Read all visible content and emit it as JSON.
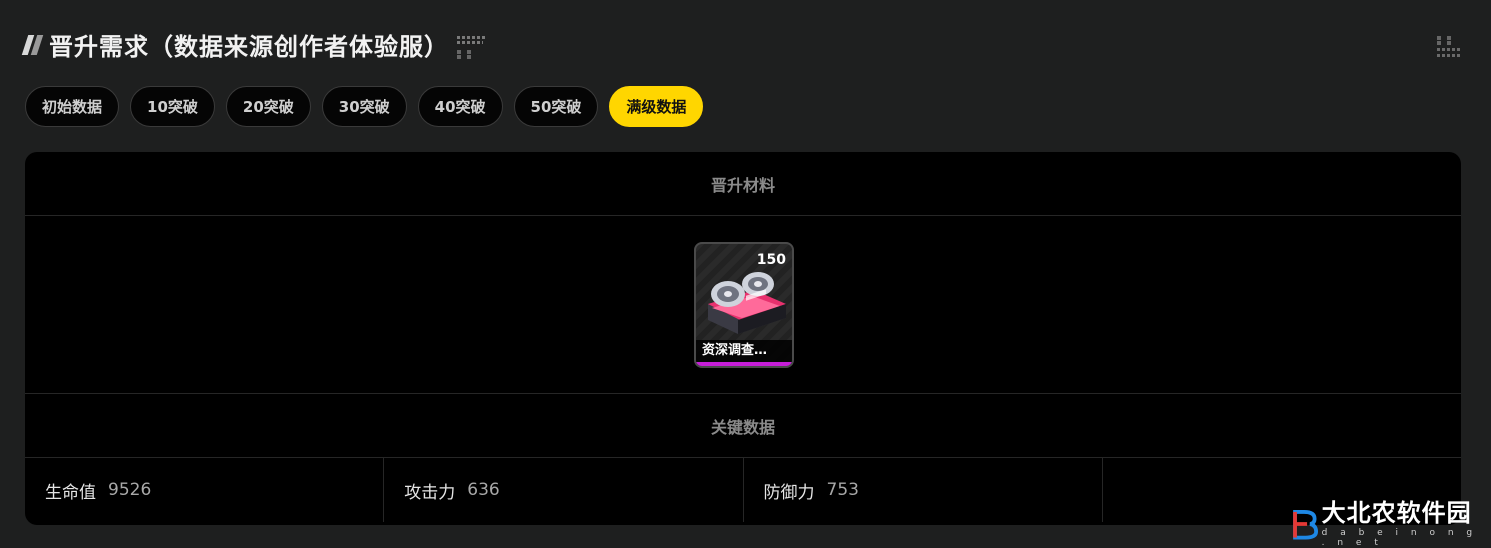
{
  "header": {
    "title": "晋升需求（数据来源创作者体验服）"
  },
  "tabs": [
    {
      "label": "初始数据",
      "active": false
    },
    {
      "label": "10突破",
      "active": false
    },
    {
      "label": "20突破",
      "active": false
    },
    {
      "label": "30突破",
      "active": false
    },
    {
      "label": "40突破",
      "active": false
    },
    {
      "label": "50突破",
      "active": false
    },
    {
      "label": "满级数据",
      "active": true
    }
  ],
  "materials": {
    "heading": "晋升材料",
    "items": [
      {
        "name": "资深调查…",
        "count": "150",
        "icon": "tape-reel-icon",
        "rarity_color": "#c61ed8"
      }
    ]
  },
  "stats": {
    "heading": "关键数据",
    "items": [
      {
        "label": "生命值",
        "value": "9526"
      },
      {
        "label": "攻击力",
        "value": "636"
      },
      {
        "label": "防御力",
        "value": "753"
      },
      {
        "label": "",
        "value": ""
      }
    ]
  },
  "watermark": {
    "name": "大北农软件园",
    "domain": "d a b e i n o n g . n e t"
  },
  "colors": {
    "accent": "#ffd600",
    "background": "#1e1f1f",
    "card": "#000000"
  }
}
